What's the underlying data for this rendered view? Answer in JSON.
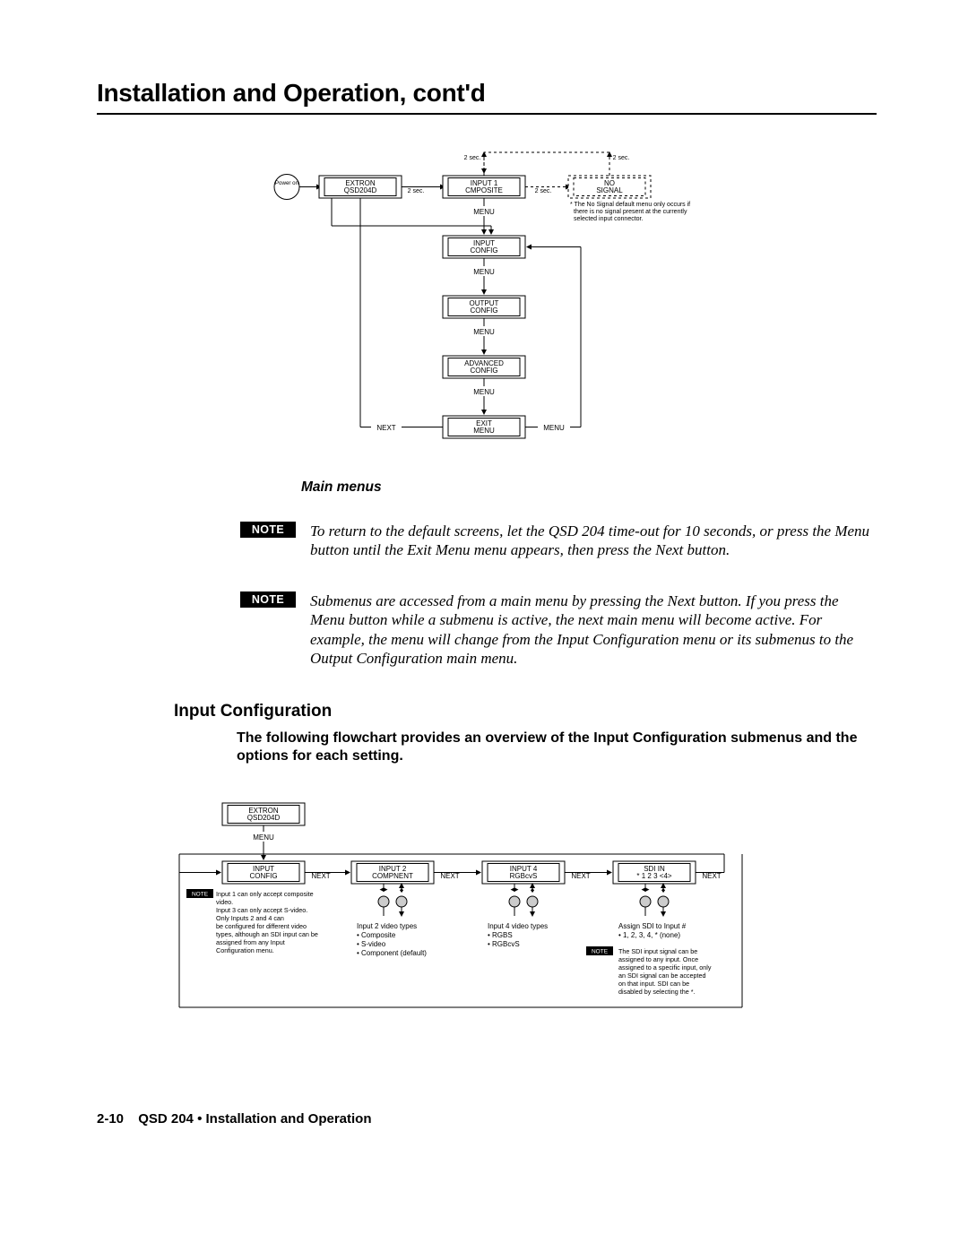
{
  "header": {
    "title": "Installation and Operation, cont'd"
  },
  "caption_main": "Main menus",
  "notes": {
    "label": "NOTE",
    "note1": "To return to the default screens, let the QSD 204 time-out for 10 seconds, or press the Menu button until the Exit Menu menu appears, then press the Next button.",
    "note2": "Submenus are accessed from a main menu by pressing the Next button.  If you press the Menu button while a submenu is active, the next main menu will become active.  For example, the menu will change from the Input Configuration menu or its submenus to the Output Configuration main menu."
  },
  "section_input": {
    "heading": "Input Configuration",
    "paragraph": "The following flowchart provides an overview of the Input Configuration submenus and the options for each setting."
  },
  "footer": {
    "page_num": "2-10",
    "title": "QSD 204 • Installation and Operation"
  },
  "diagram_main": {
    "power_on": "Power on",
    "box_extron_l1": "EXTRON",
    "box_extron_l2": "QSD204D",
    "box_input1_l1": "INPUT 1",
    "box_input1_l2": "CMPOSITE",
    "box_nosig_l1": "NO",
    "box_nosig_l2": "SIGNAL",
    "delay_2sec": "2 sec.",
    "foot_note_l1": "* The No Signal default menu only occurs if",
    "foot_note_l2": "there is no signal present at the currently",
    "foot_note_l3": "selected input connector.",
    "menu_label": "MENU",
    "box_input_cfg_l1": "INPUT",
    "box_input_cfg_l2": "CONFIG",
    "box_output_cfg_l1": "OUTPUT",
    "box_output_cfg_l2": "CONFIG",
    "box_adv_cfg_l1": "ADVANCED",
    "box_adv_cfg_l2": "CONFIG",
    "box_exit_l1": "EXIT",
    "box_exit_l2": "MENU",
    "next_label": "NEXT"
  },
  "diagram_input": {
    "box_extron_l1": "EXTRON",
    "box_extron_l2": "QSD204D",
    "menu_label": "MENU",
    "box_input_cfg_l1": "INPUT",
    "box_input_cfg_l2": "CONFIG",
    "box_inp2_l1": "INPUT 2",
    "box_inp2_l2": "COMPNENT",
    "box_inp4_l1": "INPUT 4",
    "box_inp4_l2": "RGBcvS",
    "box_sdi_l1": "SDI IN",
    "box_sdi_l2": "*  1 2 3 <4>",
    "next_label": "NEXT",
    "note_label": "NOTE",
    "left_note_l1": "Input 1 can only accept composite",
    "left_note_l2": "video.",
    "left_note_l3": "Input 3 can only accept S-video.",
    "left_note_l4": "Only Inputs 2 and 4 can",
    "left_note_l5": "be configured for different video",
    "left_note_l6": "types, although an SDI input can be",
    "left_note_l7": "assigned from any Input",
    "left_note_l8": "Configuration menu.",
    "inp2_types_title": "Input 2 video types",
    "inp2_t1": "Composite",
    "inp2_t2": "S-video",
    "inp2_t3": "Component (default)",
    "inp4_types_title": "Input 4 video types",
    "inp4_t1": "RGBS",
    "inp4_t2": "RGBcvS",
    "sdi_assign_title": "Assign SDI to Input #",
    "sdi_assign_l1": "1, 2, 3, 4, * (none)",
    "right_note_l1": "The SDI input signal can be",
    "right_note_l2": "assigned to any input.  Once",
    "right_note_l3": "assigned to a specific input, only",
    "right_note_l4": "an SDI signal can be accepted",
    "right_note_l5": "on that input.  SDI can be",
    "right_note_l6": "disabled by selecting the *."
  }
}
